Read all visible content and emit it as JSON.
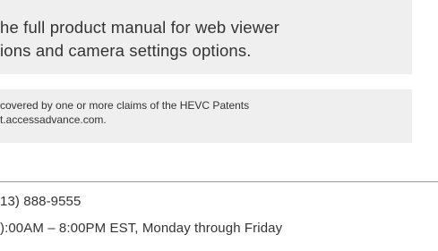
{
  "note_panel": {
    "line1": "he full product manual for web viewer",
    "line2": "ions and camera settings options."
  },
  "patent_panel": {
    "line1": "covered by one or more claims of the HEVC Patents",
    "line2": "t.accessadvance.com."
  },
  "contact": {
    "phone": "13) 888-9555",
    "hours": "):00AM – 8:00PM EST, Monday through Friday"
  }
}
